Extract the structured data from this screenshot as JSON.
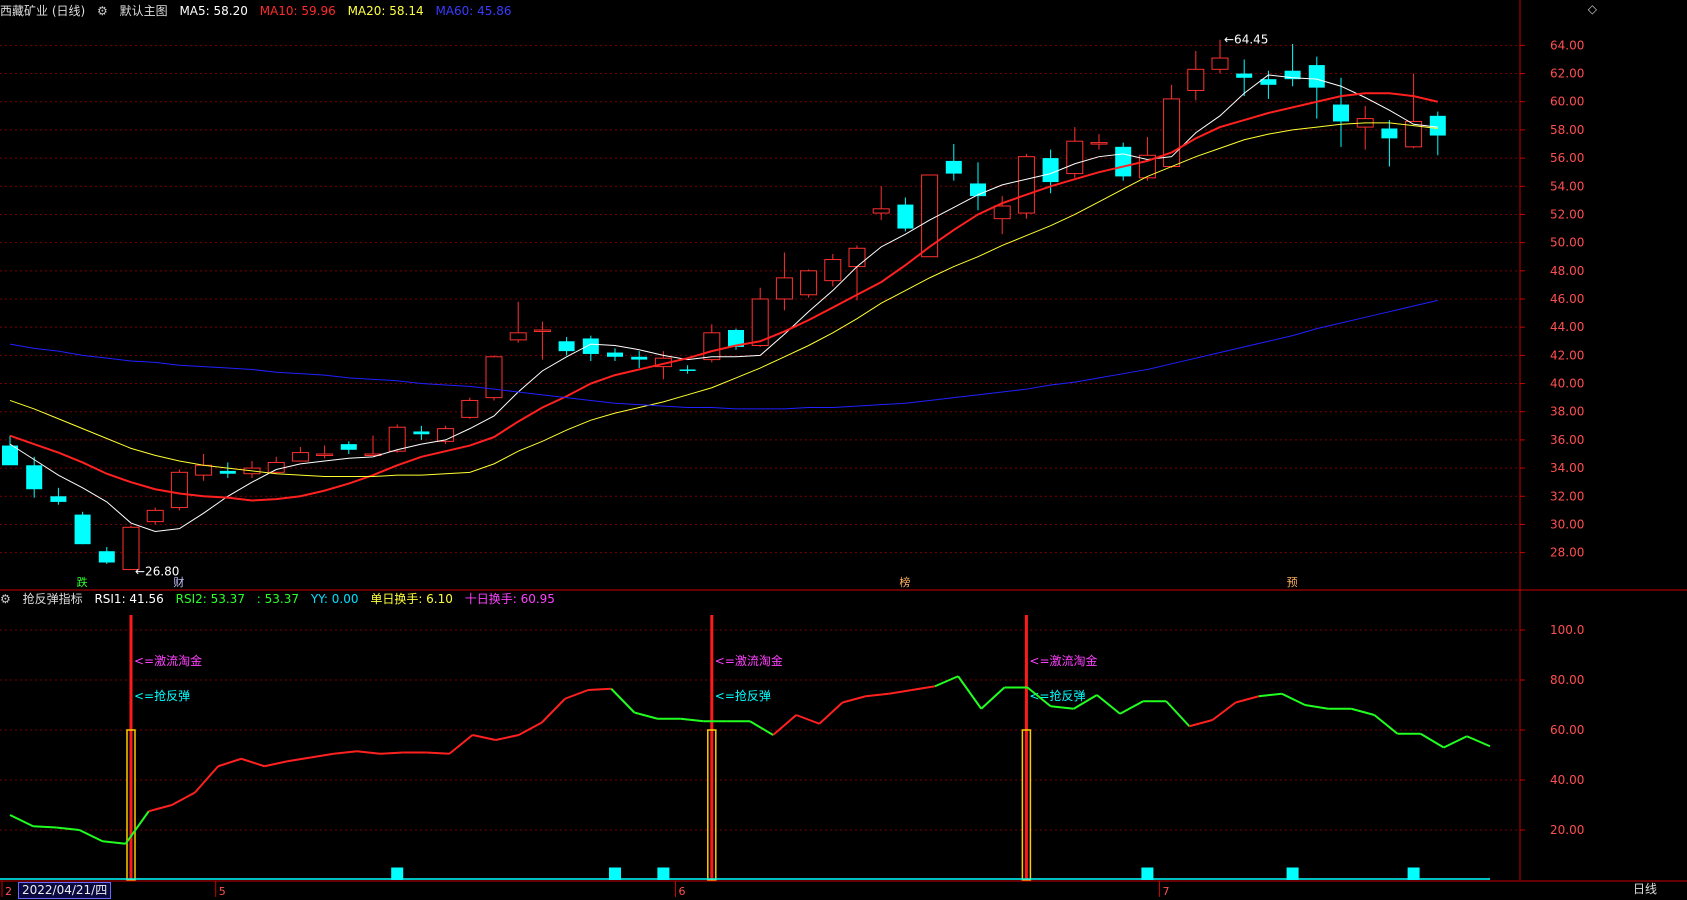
{
  "header": {
    "title": "西藏矿业 (日线)",
    "main_chart_label": "默认主图",
    "ma5_label": "MA5: 58.20",
    "ma10_label": "MA10: 59.96",
    "ma20_label": "MA20: 58.14",
    "ma60_label": "MA60: 45.86"
  },
  "indicator_header": {
    "name": "抢反弹指标",
    "rsi1": "RSI1: 41.56",
    "rsi2": "RSI2: 53.37",
    "rsi3": ": 53.37",
    "yy": "YY: 0.00",
    "single_turnover": "单日换手: 6.10",
    "ten_turnover": "十日换手: 60.95"
  },
  "footer": {
    "date": "2022/04/21/四",
    "period_button": "日线",
    "month_labels": [
      "2",
      "5",
      "6",
      "7"
    ]
  },
  "colors": {
    "up": "#ff3030",
    "down": "#00ffff",
    "ma5": "#ffffff",
    "ma10": "#ff2020",
    "ma20": "#ffff30",
    "ma60": "#2020ff",
    "grid": "#7a0000",
    "axis": "#cc0000"
  },
  "chart_data": [
    {
      "type": "candlestick",
      "title": "西藏矿业 (日线)",
      "y_ticks": [
        28,
        30,
        32,
        34,
        36,
        38,
        40,
        42,
        44,
        46,
        48,
        50,
        52,
        54,
        56,
        58,
        60,
        62,
        64
      ],
      "y_tick_labels": [
        "28.00",
        "30.00",
        "32.00",
        "34.00",
        "36.00",
        "38.00",
        "40.00",
        "42.00",
        "44.00",
        "46.00",
        "48.00",
        "50.00",
        "52.00",
        "54.00",
        "56.00",
        "58.00",
        "60.00",
        "62.00",
        "64.00"
      ],
      "ylim": [
        26.2,
        65.8
      ],
      "annotations": [
        {
          "text": "64.45",
          "index": 50
        },
        {
          "text": "26.80",
          "index": 5
        }
      ],
      "markers": [
        {
          "text": "跌",
          "index": 3
        },
        {
          "text": "财",
          "index": 7
        },
        {
          "text": "榜",
          "index": 37
        },
        {
          "text": "预",
          "index": 53
        }
      ],
      "candles": [
        {
          "o": 35.6,
          "h": 36.3,
          "l": 34.4,
          "c": 34.2
        },
        {
          "o": 34.2,
          "h": 34.8,
          "l": 31.9,
          "c": 32.5
        },
        {
          "o": 32.0,
          "h": 32.6,
          "l": 31.4,
          "c": 31.6
        },
        {
          "o": 30.7,
          "h": 30.9,
          "l": 28.6,
          "c": 28.6
        },
        {
          "o": 28.1,
          "h": 28.4,
          "l": 27.2,
          "c": 27.3
        },
        {
          "o": 26.8,
          "h": 29.9,
          "l": 26.8,
          "c": 29.8
        },
        {
          "o": 30.2,
          "h": 31.2,
          "l": 30.0,
          "c": 31.0
        },
        {
          "o": 31.2,
          "h": 33.9,
          "l": 31.0,
          "c": 33.7
        },
        {
          "o": 33.5,
          "h": 35.0,
          "l": 33.1,
          "c": 34.2
        },
        {
          "o": 33.8,
          "h": 34.4,
          "l": 33.3,
          "c": 33.6
        },
        {
          "o": 33.6,
          "h": 34.5,
          "l": 33.3,
          "c": 34.0
        },
        {
          "o": 33.7,
          "h": 34.8,
          "l": 33.6,
          "c": 34.4
        },
        {
          "o": 34.5,
          "h": 35.5,
          "l": 34.5,
          "c": 35.1
        },
        {
          "o": 35.0,
          "h": 35.6,
          "l": 34.7,
          "c": 35.0
        },
        {
          "o": 35.7,
          "h": 35.9,
          "l": 35.0,
          "c": 35.3
        },
        {
          "o": 35.0,
          "h": 36.3,
          "l": 34.9,
          "c": 35.0
        },
        {
          "o": 35.2,
          "h": 37.1,
          "l": 35.1,
          "c": 36.9
        },
        {
          "o": 36.6,
          "h": 37.0,
          "l": 36.0,
          "c": 36.4
        },
        {
          "o": 35.9,
          "h": 37.0,
          "l": 35.7,
          "c": 36.8
        },
        {
          "o": 37.6,
          "h": 39.0,
          "l": 37.5,
          "c": 38.8
        },
        {
          "o": 39.0,
          "h": 42.0,
          "l": 38.8,
          "c": 41.9
        },
        {
          "o": 43.1,
          "h": 45.8,
          "l": 42.9,
          "c": 43.6
        },
        {
          "o": 43.8,
          "h": 44.4,
          "l": 41.7,
          "c": 43.8
        },
        {
          "o": 43.0,
          "h": 43.3,
          "l": 42.0,
          "c": 42.3
        },
        {
          "o": 43.2,
          "h": 43.4,
          "l": 41.6,
          "c": 42.1
        },
        {
          "o": 42.2,
          "h": 42.5,
          "l": 41.6,
          "c": 41.9
        },
        {
          "o": 41.9,
          "h": 42.3,
          "l": 41.1,
          "c": 41.7
        },
        {
          "o": 41.2,
          "h": 42.3,
          "l": 40.3,
          "c": 41.8
        },
        {
          "o": 41.0,
          "h": 41.3,
          "l": 40.7,
          "c": 40.9
        },
        {
          "o": 41.7,
          "h": 44.2,
          "l": 41.5,
          "c": 43.6
        },
        {
          "o": 43.8,
          "h": 43.9,
          "l": 42.4,
          "c": 42.6
        },
        {
          "o": 42.7,
          "h": 46.8,
          "l": 42.6,
          "c": 46.0
        },
        {
          "o": 46.0,
          "h": 49.3,
          "l": 45.2,
          "c": 47.5
        },
        {
          "o": 46.3,
          "h": 48.1,
          "l": 46.1,
          "c": 48.0
        },
        {
          "o": 47.3,
          "h": 49.2,
          "l": 46.9,
          "c": 48.8
        },
        {
          "o": 48.3,
          "h": 49.8,
          "l": 45.9,
          "c": 49.6
        },
        {
          "o": 52.1,
          "h": 54.0,
          "l": 51.6,
          "c": 52.4
        },
        {
          "o": 52.7,
          "h": 53.2,
          "l": 50.8,
          "c": 51.0
        },
        {
          "o": 49.0,
          "h": 54.8,
          "l": 49.0,
          "c": 54.8
        },
        {
          "o": 55.8,
          "h": 57.0,
          "l": 54.4,
          "c": 54.9
        },
        {
          "o": 54.2,
          "h": 55.7,
          "l": 52.3,
          "c": 53.3
        },
        {
          "o": 51.7,
          "h": 53.3,
          "l": 50.6,
          "c": 52.6
        },
        {
          "o": 52.1,
          "h": 56.3,
          "l": 51.7,
          "c": 56.1
        },
        {
          "o": 56.0,
          "h": 56.6,
          "l": 53.5,
          "c": 54.3
        },
        {
          "o": 54.9,
          "h": 58.2,
          "l": 54.6,
          "c": 57.2
        },
        {
          "o": 57.0,
          "h": 57.7,
          "l": 56.6,
          "c": 57.1
        },
        {
          "o": 56.8,
          "h": 57.1,
          "l": 54.4,
          "c": 54.7
        },
        {
          "o": 54.6,
          "h": 57.5,
          "l": 54.4,
          "c": 56.2
        },
        {
          "o": 55.4,
          "h": 61.2,
          "l": 55.3,
          "c": 60.2
        },
        {
          "o": 60.8,
          "h": 63.6,
          "l": 60.1,
          "c": 62.3
        },
        {
          "o": 62.3,
          "h": 64.4,
          "l": 62.0,
          "c": 63.1
        },
        {
          "o": 62.0,
          "h": 63.0,
          "l": 60.4,
          "c": 61.7
        },
        {
          "o": 61.6,
          "h": 62.2,
          "l": 60.2,
          "c": 61.2
        },
        {
          "o": 62.2,
          "h": 64.1,
          "l": 61.1,
          "c": 61.6
        },
        {
          "o": 62.6,
          "h": 63.2,
          "l": 58.8,
          "c": 61.0
        },
        {
          "o": 59.8,
          "h": 61.7,
          "l": 56.8,
          "c": 58.6
        },
        {
          "o": 58.2,
          "h": 59.7,
          "l": 56.6,
          "c": 58.8
        },
        {
          "o": 58.1,
          "h": 58.7,
          "l": 55.4,
          "c": 57.4
        },
        {
          "o": 56.8,
          "h": 62.0,
          "l": 56.7,
          "c": 58.6
        },
        {
          "o": 59.0,
          "h": 59.3,
          "l": 56.2,
          "c": 57.6
        }
      ],
      "series": [
        {
          "name": "MA5",
          "values": [
            35.7,
            34.6,
            33.5,
            32.6,
            31.6,
            30.1,
            29.5,
            29.7,
            30.8,
            32.0,
            33.0,
            33.9,
            34.3,
            34.5,
            34.7,
            34.8,
            35.3,
            35.7,
            36.0,
            36.8,
            37.7,
            39.4,
            40.9,
            41.9,
            42.8,
            42.7,
            42.4,
            42.0,
            41.7,
            41.9,
            41.9,
            42.0,
            43.5,
            45.1,
            46.6,
            48.3,
            49.7,
            50.6,
            51.6,
            52.5,
            53.4,
            54.1,
            54.5,
            54.9,
            55.6,
            56.1,
            56.3,
            55.9,
            56.1,
            57.8,
            59.0,
            60.6,
            61.9,
            61.7,
            61.6,
            61.1,
            60.3,
            59.4,
            58.4,
            58.2
          ]
        },
        {
          "name": "MA10",
          "values": [
            36.3,
            35.7,
            35.1,
            34.4,
            33.6,
            33.0,
            32.5,
            32.2,
            32.0,
            31.9,
            31.7,
            31.8,
            32.0,
            32.4,
            32.9,
            33.5,
            34.2,
            34.8,
            35.2,
            35.6,
            36.2,
            37.3,
            38.3,
            39.1,
            40.0,
            40.6,
            41.0,
            41.4,
            41.8,
            42.3,
            42.7,
            43.0,
            43.7,
            44.5,
            45.4,
            46.3,
            47.2,
            48.4,
            49.7,
            50.9,
            52.0,
            52.8,
            53.4,
            54.0,
            54.5,
            55.0,
            55.4,
            55.8,
            56.4,
            57.4,
            58.2,
            58.7,
            59.2,
            59.6,
            60.0,
            60.4,
            60.6,
            60.6,
            60.4,
            60.0
          ]
        },
        {
          "name": "MA20",
          "values": [
            38.8,
            38.2,
            37.5,
            36.8,
            36.1,
            35.4,
            34.9,
            34.5,
            34.2,
            34.0,
            33.8,
            33.6,
            33.5,
            33.4,
            33.4,
            33.4,
            33.5,
            33.5,
            33.6,
            33.7,
            34.3,
            35.2,
            35.9,
            36.7,
            37.4,
            37.9,
            38.3,
            38.7,
            39.2,
            39.7,
            40.4,
            41.1,
            41.9,
            42.7,
            43.6,
            44.6,
            45.7,
            46.6,
            47.5,
            48.3,
            49.0,
            49.8,
            50.5,
            51.2,
            52.0,
            52.9,
            53.8,
            54.7,
            55.4,
            56.1,
            56.7,
            57.3,
            57.7,
            58.0,
            58.2,
            58.4,
            58.5,
            58.5,
            58.3,
            58.1
          ]
        },
        {
          "name": "MA60",
          "values": [
            42.8,
            42.5,
            42.3,
            42.0,
            41.8,
            41.6,
            41.5,
            41.3,
            41.2,
            41.1,
            41.0,
            40.8,
            40.7,
            40.6,
            40.4,
            40.3,
            40.2,
            40.0,
            39.9,
            39.8,
            39.6,
            39.4,
            39.2,
            39.0,
            38.8,
            38.6,
            38.5,
            38.4,
            38.3,
            38.3,
            38.2,
            38.2,
            38.2,
            38.3,
            38.3,
            38.4,
            38.5,
            38.6,
            38.8,
            39.0,
            39.2,
            39.4,
            39.6,
            39.9,
            40.1,
            40.4,
            40.7,
            41.0,
            41.4,
            41.8,
            42.2,
            42.6,
            43.0,
            43.4,
            43.9,
            44.3,
            44.7,
            45.1,
            45.5,
            45.9
          ]
        }
      ]
    },
    {
      "type": "line",
      "title": "抢反弹指标",
      "ylim": [
        0,
        108
      ],
      "y_ticks": [
        20,
        40,
        60,
        80,
        100
      ],
      "y_tick_labels": [
        "20.00",
        "40.00",
        "60.00",
        "80.00",
        "100.0"
      ],
      "signals": [
        {
          "index": 5,
          "labels": [
            "<=激流淘金",
            "<=抢反弹"
          ]
        },
        {
          "index": 29,
          "labels": [
            "<=激流淘金",
            "<=抢反弹"
          ]
        },
        {
          "index": 42,
          "labels": [
            "<=激流淘金",
            "<=抢反弹"
          ]
        }
      ],
      "signal_bar_value": 60,
      "signal_line_value": 100,
      "small_bars": [
        16,
        25,
        27,
        47,
        53,
        58
      ],
      "small_bar_value": 5,
      "series": [
        {
          "name": "RSI2",
          "values": [
            26,
            21.5,
            21,
            20,
            15.5,
            14.5,
            27.5,
            30,
            35,
            45.5,
            48.5,
            45.5,
            47.5,
            49,
            50.5,
            51.5,
            50.5,
            51,
            51,
            50.5,
            58,
            56,
            58,
            63,
            72.5,
            76,
            76.5,
            67,
            64.5,
            64.5,
            63.5,
            63.5,
            63.5,
            58,
            66,
            62.5,
            71,
            73.5,
            74.5,
            76,
            77.5,
            81.5,
            68.5,
            77,
            77,
            69.5,
            68.5,
            74,
            66.5,
            71.5,
            71.5,
            61.5,
            64,
            71,
            73.5,
            74.5,
            70,
            68.5,
            68.5,
            66,
            58.5,
            58.5,
            53,
            57.5,
            53.5
          ]
        }
      ]
    }
  ]
}
